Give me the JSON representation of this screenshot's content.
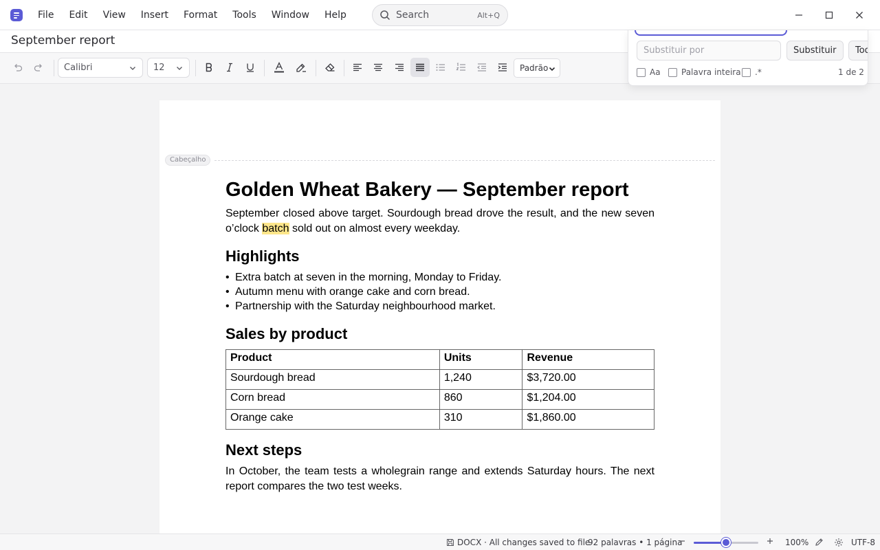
{
  "app": {
    "menu": [
      "File",
      "Edit",
      "View",
      "Insert",
      "Format",
      "Tools",
      "Window",
      "Help"
    ],
    "search": {
      "label": "Search",
      "shortcut": "Alt+Q"
    }
  },
  "document_title": "September report",
  "toolbar": {
    "font": "Calibri",
    "size": "12",
    "style": "Padrão"
  },
  "find_replace": {
    "replace_placeholder": "Substituir por",
    "replace_button": "Substituir",
    "replace_all_button": "Todos",
    "options": [
      "Aa",
      "Palavra inteira",
      ".*"
    ],
    "match_count": "1 de 2"
  },
  "page": {
    "header_tag": "Cabeçalho",
    "title": "Golden Wheat Bakery — September report",
    "intro_before": "September closed above target. Sourdough bread drove the result, and the new seven o’clock ",
    "intro_highlight": "batch",
    "intro_after": " sold out on almost every weekday.",
    "highlights_heading": "Highlights",
    "highlights": [
      "Extra batch at seven in the morning, Monday to Friday.",
      "Autumn menu with orange cake and corn bread.",
      "Partnership with the Saturday neighbourhood market."
    ],
    "sales_heading": "Sales by product",
    "table": {
      "headers": [
        "Product",
        "Units",
        "Revenue"
      ],
      "rows": [
        [
          "Sourdough bread",
          "1,240",
          "$3,720.00"
        ],
        [
          "Corn bread",
          "860",
          "$1,204.00"
        ],
        [
          "Orange cake",
          "310",
          "$1,860.00"
        ]
      ]
    },
    "next_heading": "Next steps",
    "next_text": "In October, the team tests a wholegrain range and extends Saturday hours. The next report compares the two test weeks."
  },
  "status": {
    "save_state": "DOCX · All changes saved to file",
    "word_count": "92 palavras • 1 página",
    "zoom": "100%",
    "zoom_level": 0.5,
    "encoding": "UTF-8"
  },
  "colors": {
    "accent": "#5b5bd6",
    "highlight": "#fde68a"
  }
}
